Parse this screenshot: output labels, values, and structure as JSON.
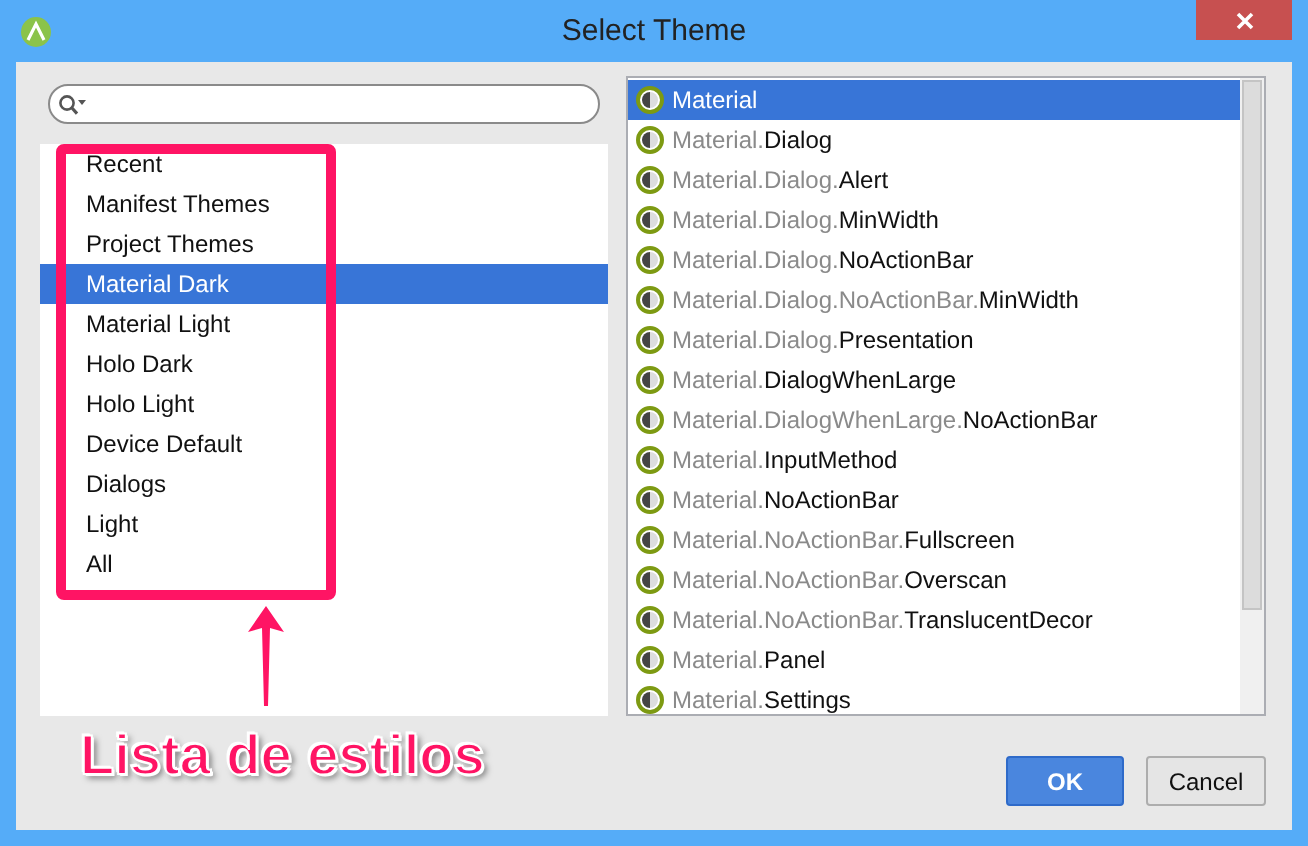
{
  "window": {
    "title": "Select Theme"
  },
  "categories": [
    {
      "label": "Recent",
      "selected": false
    },
    {
      "label": "Manifest Themes",
      "selected": false
    },
    {
      "label": "Project Themes",
      "selected": false
    },
    {
      "label": "Material Dark",
      "selected": true
    },
    {
      "label": "Material Light",
      "selected": false
    },
    {
      "label": "Holo Dark",
      "selected": false
    },
    {
      "label": "Holo Light",
      "selected": false
    },
    {
      "label": "Device Default",
      "selected": false
    },
    {
      "label": "Dialogs",
      "selected": false
    },
    {
      "label": "Light",
      "selected": false
    },
    {
      "label": "All",
      "selected": false
    }
  ],
  "themes": [
    {
      "leaf": "Material",
      "selected": true
    },
    {
      "base": "Material.",
      "leaf": "Dialog",
      "selected": false
    },
    {
      "base": "Material.Dialog.",
      "leaf": "Alert",
      "selected": false
    },
    {
      "base": "Material.Dialog.",
      "leaf": "MinWidth",
      "selected": false
    },
    {
      "base": "Material.Dialog.",
      "leaf": "NoActionBar",
      "selected": false
    },
    {
      "base": "Material.Dialog.NoActionBar.",
      "leaf": "MinWidth",
      "selected": false
    },
    {
      "base": "Material.Dialog.",
      "leaf": "Presentation",
      "selected": false
    },
    {
      "base": "Material.",
      "leaf": "DialogWhenLarge",
      "selected": false
    },
    {
      "base": "Material.DialogWhenLarge.",
      "leaf": "NoActionBar",
      "selected": false
    },
    {
      "base": "Material.",
      "leaf": "InputMethod",
      "selected": false
    },
    {
      "base": "Material.",
      "leaf": "NoActionBar",
      "selected": false
    },
    {
      "base": "Material.NoActionBar.",
      "leaf": "Fullscreen",
      "selected": false
    },
    {
      "base": "Material.NoActionBar.",
      "leaf": "Overscan",
      "selected": false
    },
    {
      "base": "Material.NoActionBar.",
      "leaf": "TranslucentDecor",
      "selected": false
    },
    {
      "base": "Material.",
      "leaf": "Panel",
      "selected": false
    },
    {
      "base": "Material.",
      "leaf": "Settings",
      "selected": false
    }
  ],
  "buttons": [
    {
      "label": "OK",
      "kind": "default"
    },
    {
      "label": "Cancel",
      "kind": "normal"
    }
  ],
  "annotation": {
    "text": "Lista de estilos"
  }
}
